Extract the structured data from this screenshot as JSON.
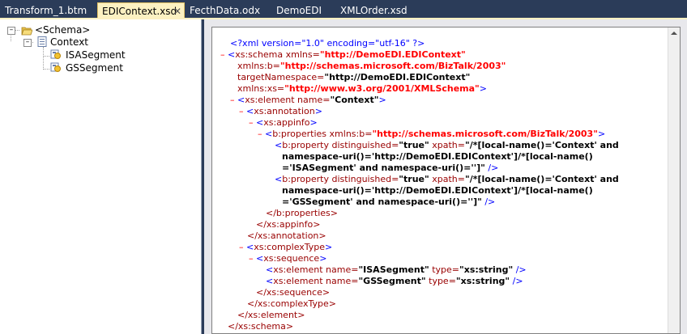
{
  "tabs": [
    {
      "label": "Transform_1.btm"
    },
    {
      "label": "EDIContext.xsd",
      "active": true,
      "close": "✕"
    },
    {
      "label": "FecthData.odx"
    },
    {
      "label": "DemoEDI"
    },
    {
      "label": "XMLOrder.xsd"
    }
  ],
  "tree": {
    "root": "<Schema>",
    "record": "Context",
    "fields": [
      "ISASegment",
      "GSSegment"
    ]
  },
  "xml": {
    "decl": "<?xml version=\"1.0\" encoding=\"utf-16\" ?>",
    "schema_open": "xs:schema xmlns=",
    "schema_ns": "\"http://DemoEDI.EDIContext\"",
    "xmlns_b": "xmlns:b=",
    "xmlns_b_val": "\"http://schemas.microsoft.com/BizTalk/2003\"",
    "target_ns": "targetNamespace=",
    "target_ns_val": "\"http://DemoEDI.EDIContext\"",
    "xmlns_xs": "xmlns:xs=",
    "xmlns_xs_val": "\"http://www.w3.org/2001/XMLSchema\"",
    "element_open": "xs:element name=",
    "element_name": "\"Context\"",
    "annotation": "xs:annotation",
    "appinfo": "xs:appinfo",
    "properties_open": "b:properties xmlns:b=",
    "properties_ns": "\"http://schemas.microsoft.com/BizTalk/2003\"",
    "property": "b:property distinguished=",
    "true_val": "\"true\"",
    "xpath": "xpath=",
    "xpath1_a": "\"/*[local-name()='Context' and",
    "xpath1_b": "namespace-uri()='http://DemoEDI.EDIContext']/*[local-name()",
    "xpath1_c": "='ISASegment' and namespace-uri()='']\"",
    "xpath2_a": "\"/*[local-name()='Context' and",
    "xpath2_b": "namespace-uri()='http://DemoEDI.EDIContext']/*[local-name()",
    "xpath2_c": "='GSSegment' and namespace-uri()='']\"",
    "properties_close": "</b:properties>",
    "appinfo_close": "</xs:appinfo>",
    "annotation_close": "</xs:annotation>",
    "complexType": "xs:complexType",
    "sequence": "xs:sequence",
    "el_name": "xs:element name=",
    "isa": "\"ISASegment\"",
    "gs": "\"GSSegment\"",
    "type_attr": "type=",
    "type_val": "\"xs:string\"",
    "sequence_close": "</xs:sequence>",
    "complexType_close": "</xs:complexType>",
    "element_close": "</xs:element>",
    "schema_close": "</xs:schema>",
    "minus": "–"
  },
  "colors": {
    "tabbar": "#2b3c59",
    "active_tab": "#fcf1c2",
    "tag": "#990000",
    "punct": "#0000ff",
    "value": "#ff0000"
  }
}
